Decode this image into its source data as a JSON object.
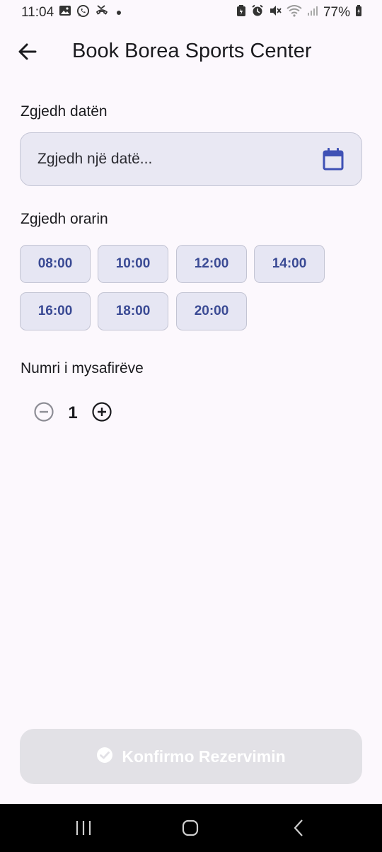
{
  "status_bar": {
    "time": "11:04",
    "battery": "77%",
    "icons_left": [
      "gallery-icon",
      "whatsapp-icon",
      "missed-call-icon",
      "notification-dot-icon"
    ],
    "icons_right": [
      "battery-saver-icon",
      "alarm-icon",
      "mute-icon",
      "wifi-icon",
      "signal-icon",
      "battery-icon"
    ]
  },
  "app_bar": {
    "title": "Book Borea Sports Center",
    "back_icon": "arrow-back-icon"
  },
  "date_section": {
    "label": "Zgjedh datën",
    "placeholder": "Zgjedh një datë...",
    "icon": "calendar-icon"
  },
  "time_section": {
    "label": "Zgjedh orarin",
    "slots": [
      "08:00",
      "10:00",
      "12:00",
      "14:00",
      "16:00",
      "18:00",
      "20:00"
    ]
  },
  "guests_section": {
    "label": "Numri i mysafirëve",
    "value": "1",
    "decrement_icon": "minus-circle-icon",
    "increment_icon": "plus-circle-icon"
  },
  "confirm": {
    "label": "Konfirmo Rezervimin",
    "icon": "check-circle-icon",
    "enabled": false
  },
  "colors": {
    "background": "#fcf8fd",
    "chip_text": "#3a4a94",
    "chip_bg": "#e6e6f3",
    "calendar_accent": "#3f51b5",
    "disabled_button": "#e2e1e6"
  },
  "nav_bar": {
    "buttons": [
      "recent-apps-icon",
      "home-icon",
      "back-icon"
    ]
  }
}
